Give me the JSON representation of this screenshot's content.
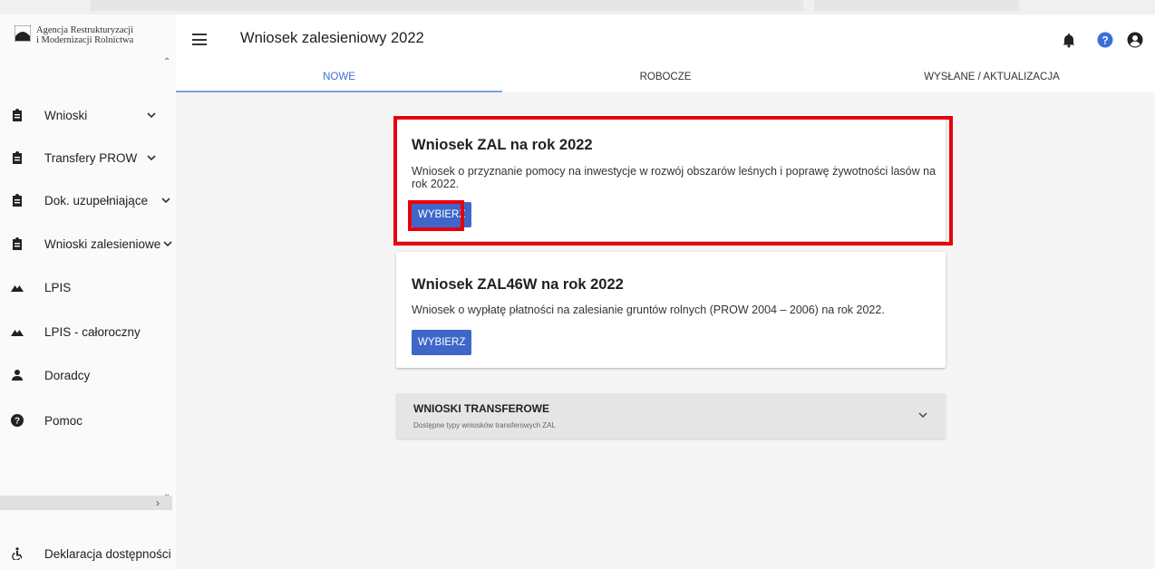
{
  "brand": {
    "line1": "Agencja Restrukturyzacji",
    "line2": "i Modernizacji Rolnictwa"
  },
  "sidebar": {
    "items": [
      {
        "label": "Wnioski",
        "icon": "clipboard-icon",
        "expandable": true
      },
      {
        "label": "Transfery PROW",
        "icon": "clipboard-icon",
        "expandable": true
      },
      {
        "label": "Dok. uzupełniające",
        "icon": "clipboard-icon",
        "expandable": true
      },
      {
        "label": "Wnioski zalesieniowe",
        "icon": "clipboard-icon",
        "expandable": true
      },
      {
        "label": "LPIS",
        "icon": "mountain-icon",
        "expandable": false
      },
      {
        "label": "LPIS - całoroczny",
        "icon": "mountain-icon",
        "expandable": false
      },
      {
        "label": "Doradcy",
        "icon": "person-icon",
        "expandable": false
      },
      {
        "label": "Pomoc",
        "icon": "help-circle-icon",
        "expandable": false
      }
    ],
    "footer": {
      "label": "Deklaracja dostępności",
      "icon": "accessibility-icon"
    }
  },
  "header": {
    "title": "Wniosek zalesieniowy 2022",
    "icons": [
      "bell-icon",
      "help-icon",
      "account-icon"
    ]
  },
  "tabs": [
    {
      "label": "NOWE",
      "active": true
    },
    {
      "label": "ROBOCZE",
      "active": false
    },
    {
      "label": "WYSŁANE / AKTUALIZACJA",
      "active": false
    }
  ],
  "cards": [
    {
      "title": "Wniosek ZAL na rok 2022",
      "desc_line1": "Wniosek o przyznanie pomocy na inwestycje w rozwój obszarów leśnych i poprawę żywotności lasów na",
      "desc_line2": "rok 2022.",
      "button": "WYBIERZ",
      "highlighted": true
    },
    {
      "title": "Wniosek ZAL46W na rok 2022",
      "desc_line1": "Wniosek o wypłatę płatności na zalesianie gruntów rolnych (PROW 2004 – 2006) na rok 2022.",
      "button": "WYBIERZ",
      "highlighted": false
    }
  ],
  "transfer": {
    "title": "WNIOSKI TRANSFEROWE",
    "subtitle": "Dostępne typy wniosków transferowych ZAL"
  },
  "colors": {
    "accent": "#3e67c9",
    "highlight": "#e8000b",
    "help_icon": "#3a6fd8"
  }
}
